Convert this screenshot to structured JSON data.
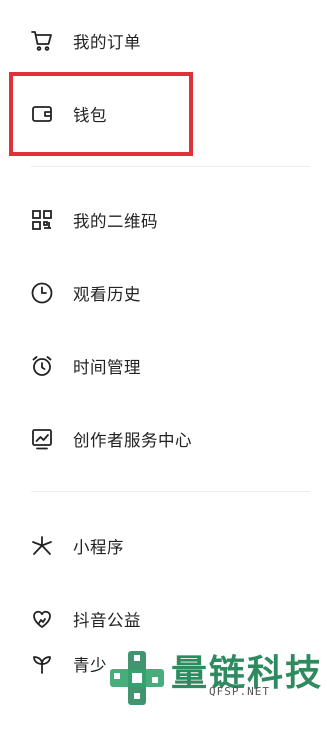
{
  "menu_group_1": [
    {
      "label": "我的订单",
      "icon": "cart-icon"
    },
    {
      "label": "钱包",
      "icon": "wallet-icon"
    }
  ],
  "menu_group_2": [
    {
      "label": "我的二维码",
      "icon": "qr-code-icon"
    },
    {
      "label": "观看历史",
      "icon": "clock-icon"
    },
    {
      "label": "时间管理",
      "icon": "alarm-clock-icon"
    },
    {
      "label": "创作者服务中心",
      "icon": "chart-monitor-icon"
    }
  ],
  "menu_group_3": [
    {
      "label": "小程序",
      "icon": "mini-program-icon"
    },
    {
      "label": "抖音公益",
      "icon": "heart-icon"
    },
    {
      "label": "青少",
      "icon": "sprout-icon"
    }
  ],
  "highlight": {
    "target": "钱包",
    "color": "#e0313a"
  },
  "watermark": {
    "brand": "量链科技",
    "domain": "QFSP.NET",
    "color": "#2e8a5f"
  }
}
